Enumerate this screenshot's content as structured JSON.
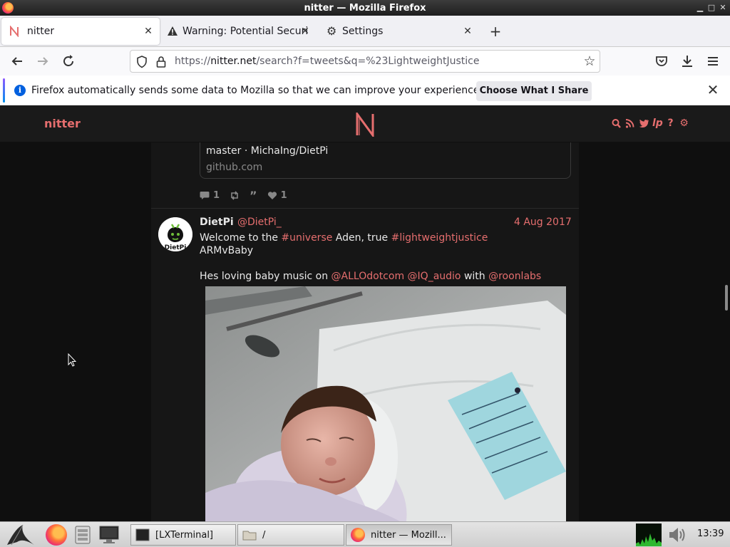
{
  "window": {
    "title": "nitter — Mozilla Firefox"
  },
  "tabs": [
    {
      "label": "nitter",
      "icon": "nitter-n-icon",
      "active": true
    },
    {
      "label": "Warning: Potential Securi",
      "icon": "warning-icon",
      "active": false
    },
    {
      "label": "Settings",
      "icon": "gear-icon",
      "active": false
    }
  ],
  "navbar": {
    "url_prefix": "https://",
    "url_host": "nitter.net",
    "url_path": "/search?f=tweets&q=%23LightweightJustice"
  },
  "notification": {
    "message": "Firefox automatically sends some data to Mozilla so that we can improve your experience.",
    "button_label": "Choose What I Share"
  },
  "nitter": {
    "brand": "nitter",
    "logo_letter": "N"
  },
  "prev_tweet": {
    "card_line1": "master · MichaIng/DietPi",
    "card_domain": "github.com",
    "replies": "1",
    "likes": "1"
  },
  "tweet": {
    "fullname": "DietPi",
    "username": "@DietPi_",
    "date": "4 Aug 2017",
    "avatar_text": "DietPi",
    "text_part1": "Welcome to the ",
    "hashtag1": "#universe",
    "text_part2": " Aden, true ",
    "hashtag2": "#lightweightjustice",
    "line2": "ARMvBaby",
    "line3_part1": "Hes loving baby music on ",
    "mention1": "@ALLOdotcom",
    "mention2": "@IQ_audio",
    "line3_part2": " with ",
    "mention3": "@roonlabs"
  },
  "taskbar": {
    "apps": [
      {
        "label": "[LXTerminal]",
        "icon": "terminal-icon"
      },
      {
        "label": "/",
        "icon": "folder-icon"
      },
      {
        "label": "nitter — Mozill...",
        "icon": "firefox-icon",
        "active": true
      }
    ],
    "clock": "13:39"
  },
  "colors": {
    "accent": "#e56e6e",
    "nitter_bg": "#0f0f0f",
    "timeline_bg": "#161616"
  }
}
